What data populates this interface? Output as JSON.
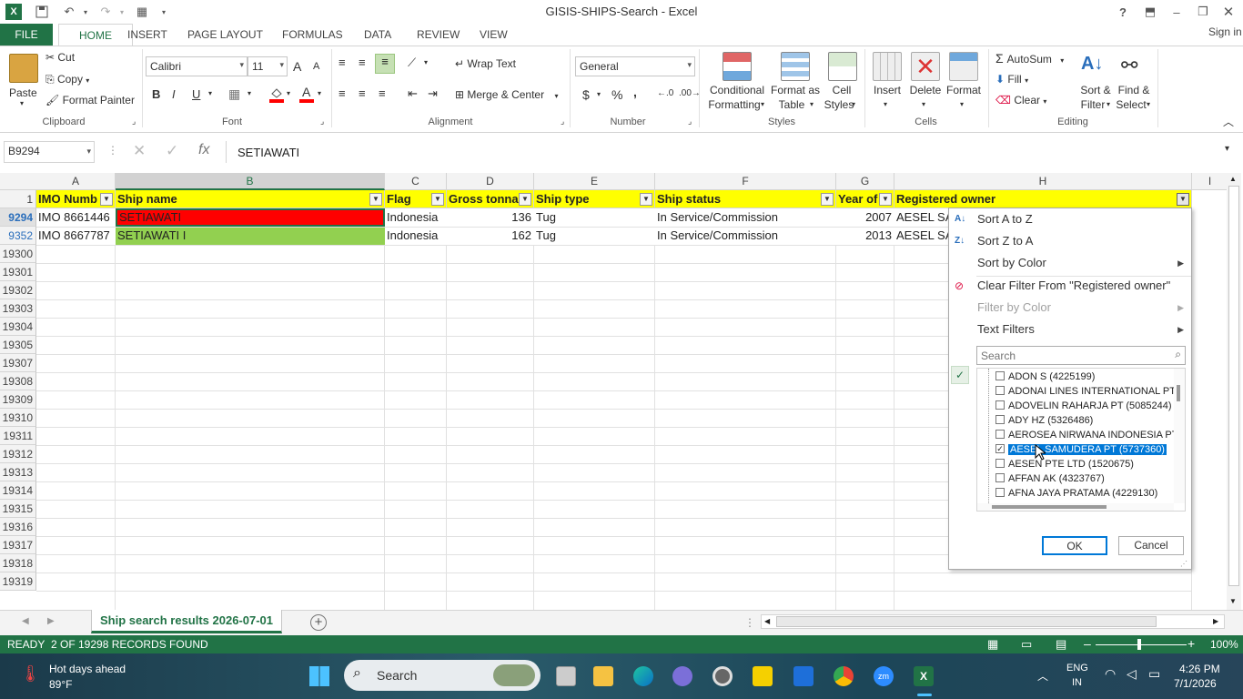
{
  "window": {
    "title": "GISIS-SHIPS-Search - Excel",
    "help": "?",
    "signin": "Sign in"
  },
  "tabs": [
    "FILE",
    "HOME",
    "INSERT",
    "PAGE LAYOUT",
    "FORMULAS",
    "DATA",
    "REVIEW",
    "VIEW"
  ],
  "ribbon": {
    "clipboard": {
      "paste": "Paste",
      "cut": "Cut",
      "copy": "Copy",
      "format_painter": "Format Painter",
      "label": "Clipboard"
    },
    "font": {
      "name": "Calibri",
      "size": "11",
      "bold": "B",
      "italic": "I",
      "underline": "U",
      "grow": "A",
      "shrink": "A",
      "color_a": "A",
      "label": "Font"
    },
    "alignment": {
      "wrap": "Wrap Text",
      "merge": "Merge & Center",
      "label": "Alignment"
    },
    "number": {
      "format": "General",
      "currency": "$",
      "percent": "%",
      "comma": ",",
      "label": "Number"
    },
    "styles": {
      "conditional": "Conditional",
      "conditional2": "Formatting",
      "format_table": "Format as",
      "format_table2": "Table",
      "cell_styles": "Cell",
      "cell_styles2": "Styles",
      "label": "Styles"
    },
    "cells": {
      "insert": "Insert",
      "delete": "Delete",
      "format": "Format",
      "label": "Cells"
    },
    "editing": {
      "autosum": "AutoSum",
      "fill": "Fill",
      "clear": "Clear",
      "sort": "Sort &",
      "sort2": "Filter",
      "find": "Find &",
      "find2": "Select",
      "label": "Editing"
    }
  },
  "formula_bar": {
    "name_box": "B9294",
    "fx": "fx",
    "value": "SETIAWATI"
  },
  "columns": [
    {
      "letter": "A"
    },
    {
      "letter": "B"
    },
    {
      "letter": "C"
    },
    {
      "letter": "D"
    },
    {
      "letter": "E"
    },
    {
      "letter": "F"
    },
    {
      "letter": "G"
    },
    {
      "letter": "H"
    },
    {
      "letter": "I"
    }
  ],
  "header_row": {
    "row_num": "1",
    "cells": [
      "IMO Numb",
      "Ship name",
      "Flag",
      "Gross tonnag",
      "Ship type",
      "Ship status",
      "Year of",
      "Registered owner"
    ]
  },
  "data_rows": [
    {
      "row_num": "9294",
      "imo": "IMO 8661446",
      "ship": "SETIAWATI",
      "flag": "Indonesia",
      "gt": "136",
      "type": "Tug",
      "status": "In Service/Commission",
      "year": "2007",
      "owner": "AESEL SA"
    },
    {
      "row_num": "9352",
      "imo": "IMO 8667787",
      "ship": "SETIAWATI I",
      "flag": "Indonesia",
      "gt": "162",
      "type": "Tug",
      "status": "In Service/Commission",
      "year": "2013",
      "owner": "AESEL SA"
    }
  ],
  "empty_rows": [
    "19300",
    "19301",
    "19302",
    "19303",
    "19304",
    "19305",
    "19307",
    "19308",
    "19309",
    "19310",
    "19311",
    "19312",
    "19313",
    "19314",
    "19315",
    "19316",
    "19317",
    "19318",
    "19319"
  ],
  "filter_menu": {
    "sort_az": "Sort A to Z",
    "sort_za": "Sort Z to A",
    "sort_color": "Sort by Color",
    "clear_filter": "Clear Filter From \"Registered owner\"",
    "filter_color": "Filter by Color",
    "text_filters": "Text Filters",
    "search_placeholder": "Search",
    "items": [
      {
        "label": "ADON S (4225199)",
        "checked": false
      },
      {
        "label": "ADONAI LINES INTERNATIONAL PT",
        "checked": false
      },
      {
        "label": "ADOVELIN RAHARJA PT (5085244)",
        "checked": false
      },
      {
        "label": "ADY HZ (5326486)",
        "checked": false
      },
      {
        "label": "AEROSEA NIRWANA INDONESIA PT",
        "checked": false
      },
      {
        "label": "AESEL SAMUDERA PT (5737360)",
        "checked": true
      },
      {
        "label": "AESEN PTE LTD (1520675)",
        "checked": false
      },
      {
        "label": "AFFAN AK (4323767)",
        "checked": false
      },
      {
        "label": "AFNA JAYA PRATAMA (4229130)",
        "checked": false
      }
    ],
    "ok": "OK",
    "cancel": "Cancel"
  },
  "sheet_tab": "Ship search results 2026-07-01",
  "status": {
    "ready": "READY",
    "records": "2 OF 19298 RECORDS FOUND",
    "zoom": "100%"
  },
  "taskbar": {
    "weather_title": "Hot days ahead",
    "weather_temp": "89°F",
    "search": "Search",
    "lang": "ENG",
    "lang2": "IN",
    "time": "4:26 PM",
    "date": "7/1/2026"
  },
  "colors": {
    "excel_green": "#217346",
    "header_yellow": "#ffff00",
    "red_cell": "#ff0000",
    "green_cell": "#92d050",
    "selection": "#0078d7"
  }
}
